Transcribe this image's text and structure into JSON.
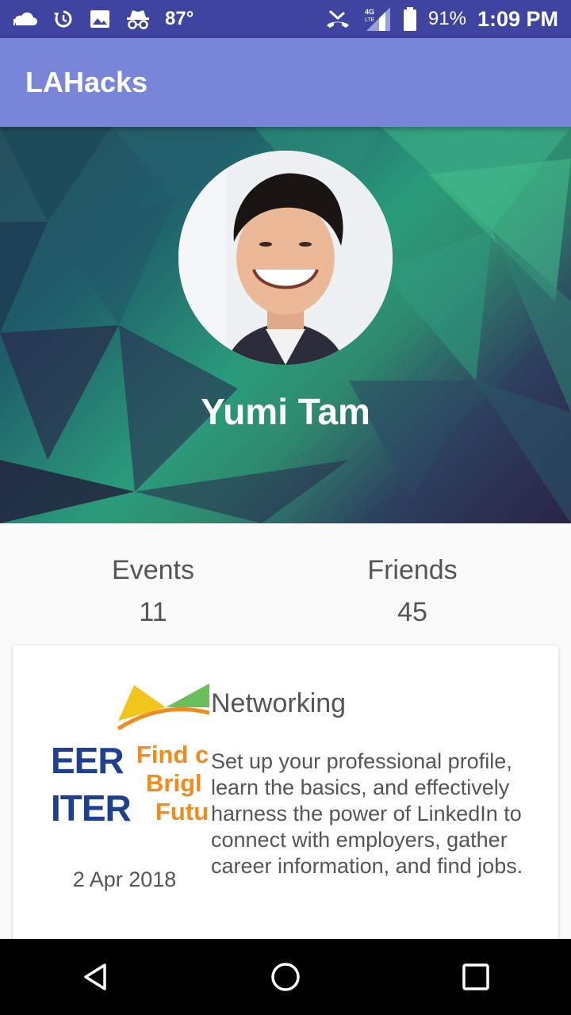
{
  "status_bar": {
    "temperature": "87°",
    "network": "4G LTE",
    "battery": "91%",
    "time": "1:09 PM",
    "icons": [
      "cloud-icon",
      "sync-icon",
      "image-icon",
      "incognito-icon",
      "missed-call-icon",
      "signal-icon",
      "battery-icon"
    ]
  },
  "app_bar": {
    "title": "LAHacks"
  },
  "profile": {
    "name": "Yumi Tam"
  },
  "stats": {
    "events": {
      "label": "Events",
      "value": "11"
    },
    "friends": {
      "label": "Friends",
      "value": "45"
    }
  },
  "event_card": {
    "title": "Networking",
    "date": "2 Apr 2018",
    "description": "Set up your professional profile, learn the basics, and  effectively harness the power of LinkedIn to connect with  employers, gather career information, and find jobs.",
    "image_text": {
      "line1": "EER",
      "line2": "ITER",
      "tag1": "Find c",
      "tag2": "Brigl",
      "tag3": "Futu"
    }
  },
  "nav_bar": {
    "icons": [
      "back-icon",
      "home-icon",
      "recents-icon"
    ]
  },
  "colors": {
    "status_bar": "#3f44a0",
    "app_bar": "#7986d8",
    "navy": "#1f3f8f",
    "orange": "#f08c1e",
    "yellow": "#f1c51b",
    "green": "#6bbf5a"
  }
}
